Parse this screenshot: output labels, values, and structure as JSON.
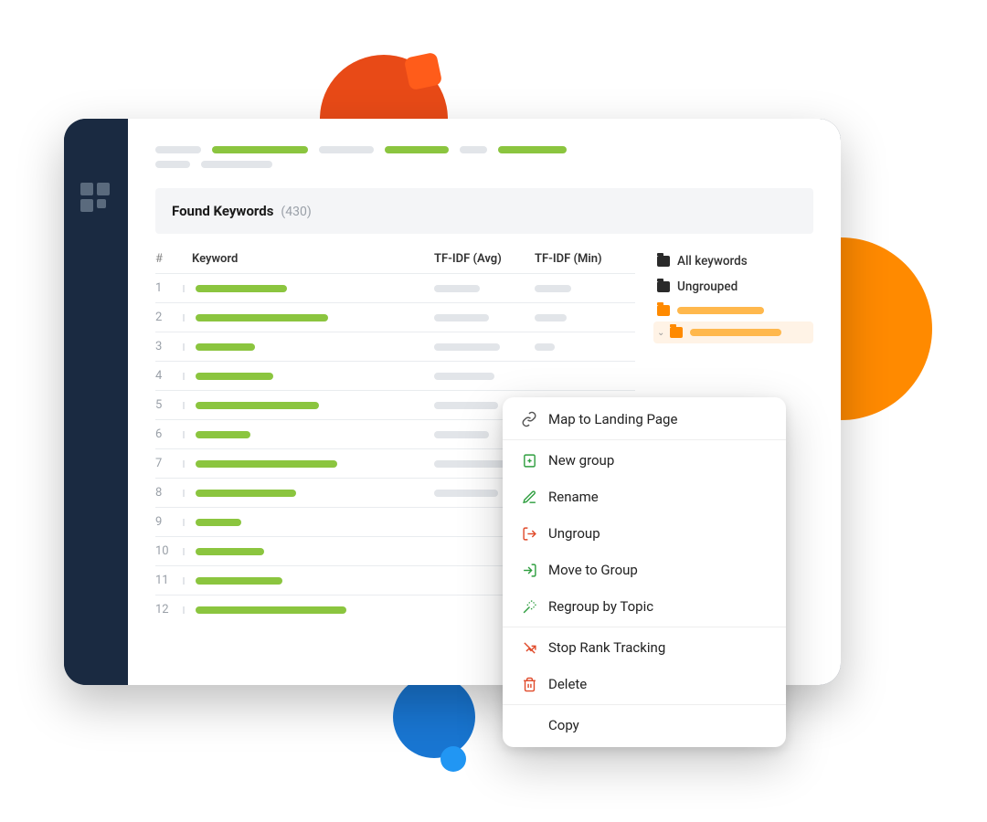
{
  "section": {
    "title": "Found Keywords",
    "count": "(430)"
  },
  "columns": {
    "num": "#",
    "keyword": "Keyword",
    "avg": "TF-IDF (Avg)",
    "min": "TF-IDF (Min)"
  },
  "rows": [
    {
      "n": "1",
      "kw_w": 100,
      "avg_w": 50,
      "min_w": 40
    },
    {
      "n": "2",
      "kw_w": 145,
      "avg_w": 60,
      "min_w": 35
    },
    {
      "n": "3",
      "kw_w": 65,
      "avg_w": 72,
      "min_w": 22
    },
    {
      "n": "4",
      "kw_w": 85,
      "avg_w": 66,
      "min_w": 0
    },
    {
      "n": "5",
      "kw_w": 135,
      "avg_w": 70,
      "min_w": 0
    },
    {
      "n": "6",
      "kw_w": 60,
      "avg_w": 60,
      "min_w": 0
    },
    {
      "n": "7",
      "kw_w": 155,
      "avg_w": 80,
      "min_w": 0
    },
    {
      "n": "8",
      "kw_w": 110,
      "avg_w": 70,
      "min_w": 0
    },
    {
      "n": "9",
      "kw_w": 50,
      "avg_w": 0,
      "min_w": 0
    },
    {
      "n": "10",
      "kw_w": 75,
      "avg_w": 0,
      "min_w": 0
    },
    {
      "n": "11",
      "kw_w": 95,
      "avg_w": 0,
      "min_w": 0
    },
    {
      "n": "12",
      "kw_w": 165,
      "avg_w": 0,
      "min_w": 0
    }
  ],
  "groups": {
    "all": "All keywords",
    "ungrouped": "Ungrouped"
  },
  "menu": {
    "map": "Map to Landing Page",
    "new_group": "New group",
    "rename": "Rename",
    "ungroup": "Ungroup",
    "move": "Move to Group",
    "regroup": "Regroup by Topic",
    "stop_track": "Stop Rank Tracking",
    "delete": "Delete",
    "copy": "Copy"
  }
}
